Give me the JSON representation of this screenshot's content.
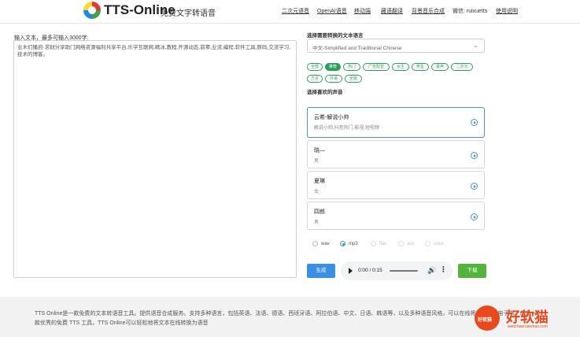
{
  "header": {
    "brand": "TTS-Online",
    "subtitle": "免费文字转语音",
    "nav": [
      "二次元语音",
      "OpenAI语音",
      "移动端",
      "藏语翻译",
      "背景音乐合成",
      "微信: ruixuetts",
      "使用说明"
    ]
  },
  "input": {
    "label": "输入文本，最多可输入3000字:",
    "content": "业木们播府·求财分享助门网络资源福利共享平台,乐学互联网,精冰,教程,开源动态,前辈,业流,编程,软件工具,原码,交流学习,技术的博客。"
  },
  "language": {
    "label": "选择需要转换的文本语言",
    "selected": "中文-Simplified and Traditional Chinese"
  },
  "tags": [
    "全部",
    "推荐",
    "热门",
    "广告配音",
    "女生",
    "男生",
    "童声",
    "二次元",
    "方言",
    "外语",
    "全能"
  ],
  "voices": {
    "label": "选择喜欢的声音",
    "items": [
      {
        "name": "云希-解说小帅",
        "desc": "解说小帅,抖音热门,影视,短视频"
      },
      {
        "name": "晓—",
        "desc": "男"
      },
      {
        "name": "夏琳",
        "desc": "女"
      },
      {
        "name": "四郎",
        "desc": "男"
      }
    ]
  },
  "formats": [
    "wav",
    "mp3",
    "flac",
    "aac",
    "opus"
  ],
  "actions": {
    "generate": "生成",
    "download": "下载"
  },
  "player": {
    "time": "0:00 / 0:15"
  },
  "footer": {
    "text": "TTS Online是一款免费的文本转语音工具。提供语音合成服务。支持多种语言，包括英语、法语、德语、西班牙语、阿拉伯语、中文、日语、韩语等，以及多种语音风格，可以在线将文本转成电子书。作为一款优秀的免费 TTS 工具，TTS Online可以轻松地将文本在线转换为语音"
  },
  "watermark": {
    "small": "好软猫",
    "big": "好软猫",
    "url": "www.haoruanmao.com"
  },
  "colors": {
    "accent": "#2e9e5b",
    "primary": "#3a8ee6",
    "download": "#52b43a",
    "watermark": "#e8491d"
  }
}
